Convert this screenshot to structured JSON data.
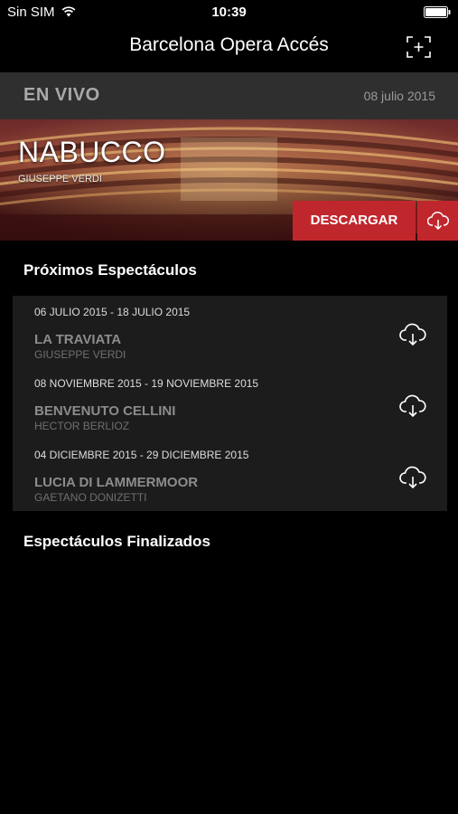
{
  "status_bar": {
    "carrier": "Sin SIM",
    "time": "10:39",
    "wifi_icon": "wifi-icon",
    "battery_icon": "battery-icon"
  },
  "nav": {
    "title": "Barcelona Opera Accés",
    "action_icon": "expand-icon"
  },
  "live": {
    "label": "EN VIVO",
    "date": "08 julio 2015",
    "title": "NABUCCO",
    "composer": "GIUSEPPE VERDI",
    "download_label": "DESCARGAR",
    "download_icon": "cloud-download-icon"
  },
  "upcoming": {
    "heading": "Próximos Espectáculos",
    "items": [
      {
        "dates": "06 JULIO 2015 - 18 JULIO 2015",
        "title": "LA TRAVIATA",
        "composer": "GIUSEPPE VERDI"
      },
      {
        "dates": "08 NOVIEMBRE 2015 - 19 NOVIEMBRE 2015",
        "title": "BENVENUTO CELLINI",
        "composer": "HECTOR BERLIOZ"
      },
      {
        "dates": "04 DICIEMBRE 2015 - 29 DICIEMBRE 2015",
        "title": "LUCIA DI LAMMERMOOR",
        "composer": "GAETANO DONIZETTI"
      }
    ]
  },
  "finished": {
    "heading": "Espectáculos Finalizados"
  },
  "colors": {
    "accent": "#c0272d",
    "header_bar": "#2f2f2f",
    "list_bg": "#1c1c1c"
  }
}
